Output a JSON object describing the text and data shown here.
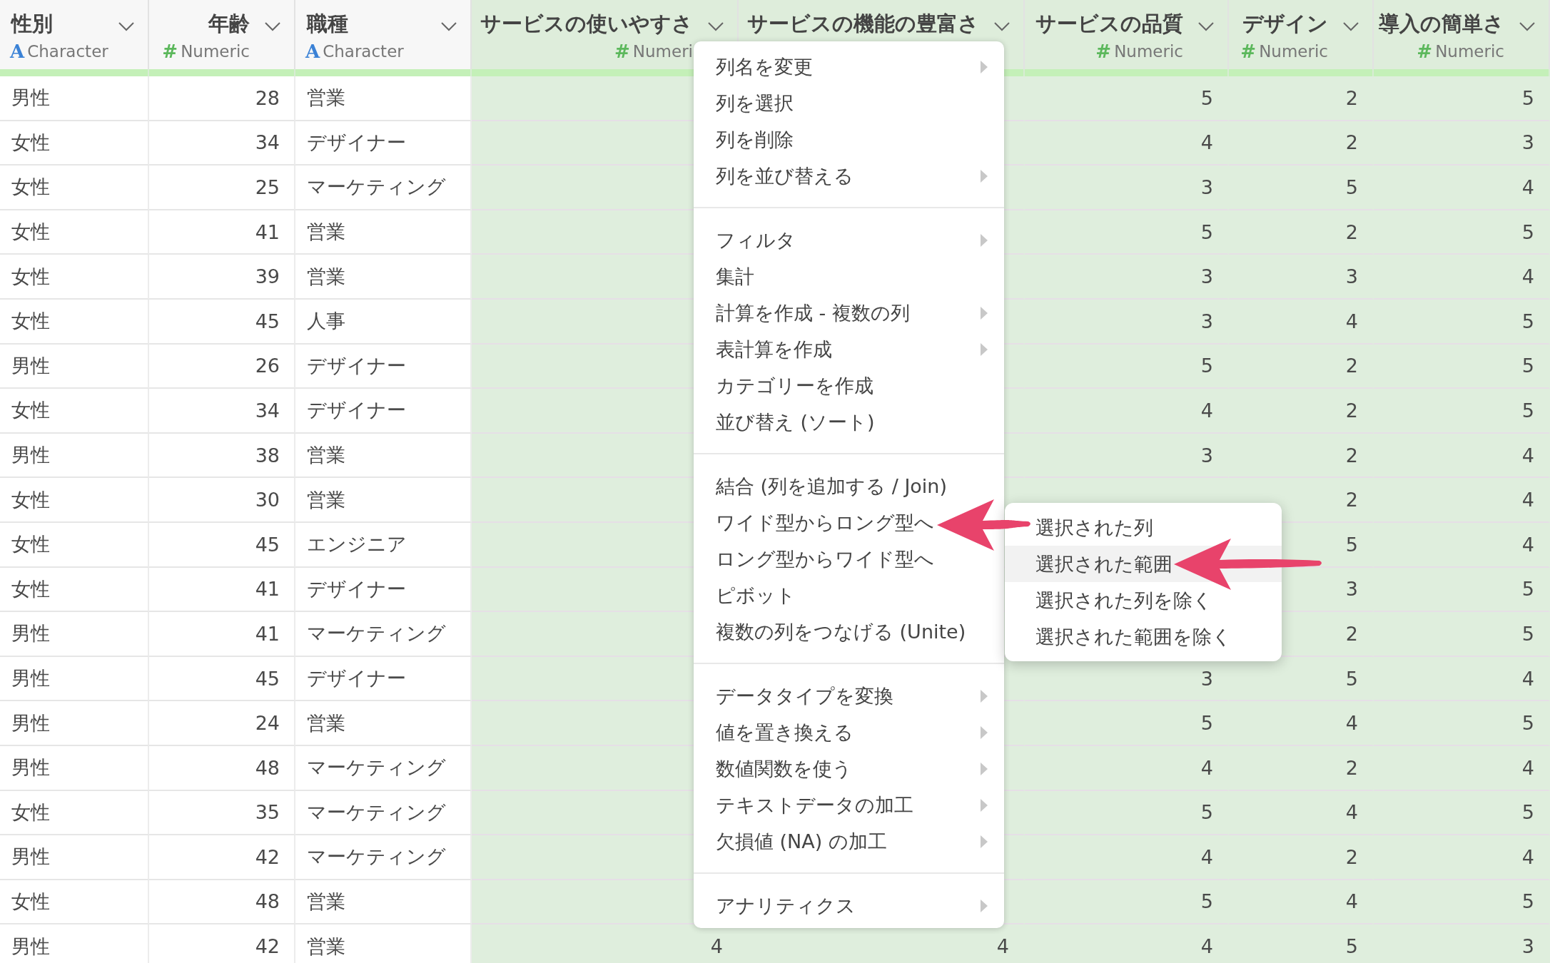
{
  "table": {
    "columns": [
      {
        "title": "性別",
        "selected": false,
        "kind": "character",
        "type": {
          "kind": "character",
          "icon": "A",
          "label": "Character"
        }
      },
      {
        "title": "年齢",
        "selected": false,
        "kind": "numeric",
        "type": {
          "kind": "numeric",
          "icon": "#",
          "label": "Numeric"
        }
      },
      {
        "title": "職種",
        "selected": false,
        "kind": "character",
        "type": {
          "kind": "character",
          "icon": "A",
          "label": "Character"
        }
      },
      {
        "title": "サービスの使いやすさ",
        "selected": true,
        "kind": "numeric",
        "type": {
          "kind": "numeric",
          "icon": "#",
          "label": "Numeri"
        }
      },
      {
        "title": "サービスの機能の豊富さ",
        "selected": true,
        "kind": "numeric"
      },
      {
        "title": "サービスの品質",
        "selected": true,
        "kind": "numeric",
        "type": {
          "kind": "numeric",
          "icon": "#",
          "label": "Numeric"
        }
      },
      {
        "title": "デザイン",
        "selected": true,
        "kind": "numeric",
        "type": {
          "kind": "numeric",
          "icon": "#",
          "label": "Numeric"
        }
      },
      {
        "title": "導入の簡単さ",
        "selected": true,
        "kind": "numeric",
        "type": {
          "kind": "numeric",
          "icon": "#",
          "label": "Numeric"
        }
      }
    ],
    "rows": [
      [
        "男性",
        "28",
        "営業",
        null,
        null,
        "5",
        "2",
        "5"
      ],
      [
        "女性",
        "34",
        "デザイナー",
        null,
        null,
        "4",
        "2",
        "3"
      ],
      [
        "女性",
        "25",
        "マーケティング",
        null,
        null,
        "3",
        "5",
        "4"
      ],
      [
        "女性",
        "41",
        "営業",
        null,
        null,
        "5",
        "2",
        "5"
      ],
      [
        "女性",
        "39",
        "営業",
        null,
        null,
        "3",
        "3",
        "4"
      ],
      [
        "女性",
        "45",
        "人事",
        null,
        null,
        "3",
        "4",
        "5"
      ],
      [
        "男性",
        "26",
        "デザイナー",
        null,
        null,
        "5",
        "2",
        "5"
      ],
      [
        "女性",
        "34",
        "デザイナー",
        null,
        null,
        "4",
        "2",
        "5"
      ],
      [
        "男性",
        "38",
        "営業",
        null,
        null,
        "3",
        "2",
        "4"
      ],
      [
        "女性",
        "30",
        "営業",
        null,
        null,
        null,
        "2",
        "4"
      ],
      [
        "女性",
        "45",
        "エンジニア",
        null,
        null,
        null,
        "5",
        "4"
      ],
      [
        "女性",
        "41",
        "デザイナー",
        null,
        null,
        null,
        "3",
        "5"
      ],
      [
        "男性",
        "41",
        "マーケティング",
        null,
        null,
        null,
        "2",
        "5"
      ],
      [
        "男性",
        "45",
        "デザイナー",
        null,
        null,
        "3",
        "5",
        "4"
      ],
      [
        "男性",
        "24",
        "営業",
        null,
        null,
        "5",
        "4",
        "5"
      ],
      [
        "男性",
        "48",
        "マーケティング",
        null,
        null,
        "4",
        "2",
        "4"
      ],
      [
        "女性",
        "35",
        "マーケティング",
        null,
        null,
        "5",
        "4",
        "5"
      ],
      [
        "男性",
        "42",
        "マーケティング",
        null,
        null,
        "4",
        "2",
        "4"
      ],
      [
        "女性",
        "48",
        "営業",
        null,
        null,
        "5",
        "4",
        "5"
      ],
      [
        "男性",
        "42",
        "営業",
        "4",
        "4",
        "4",
        "5",
        "3"
      ]
    ]
  },
  "context_menu": {
    "groups": [
      [
        {
          "label": "列名を変更",
          "has_submenu": true
        },
        {
          "label": "列を選択",
          "has_submenu": false
        },
        {
          "label": "列を削除",
          "has_submenu": false
        },
        {
          "label": "列を並び替える",
          "has_submenu": true
        }
      ],
      [
        {
          "label": "フィルタ",
          "has_submenu": true
        },
        {
          "label": "集計",
          "has_submenu": false
        },
        {
          "label": "計算を作成 - 複数の列",
          "has_submenu": true
        },
        {
          "label": "表計算を作成",
          "has_submenu": true
        },
        {
          "label": "カテゴリーを作成",
          "has_submenu": false
        },
        {
          "label": "並び替え (ソート)",
          "has_submenu": false
        }
      ],
      [
        {
          "label": "結合 (列を追加する / Join)",
          "has_submenu": false
        },
        {
          "label": "ワイド型からロング型へ",
          "has_submenu": false
        },
        {
          "label": "ロング型からワイド型へ",
          "has_submenu": false
        },
        {
          "label": "ピボット",
          "has_submenu": false
        },
        {
          "label": "複数の列をつなげる (Unite)",
          "has_submenu": false
        }
      ],
      [
        {
          "label": "データタイプを変換",
          "has_submenu": true
        },
        {
          "label": "値を置き換える",
          "has_submenu": true
        },
        {
          "label": "数値関数を使う",
          "has_submenu": true
        },
        {
          "label": "テキストデータの加工",
          "has_submenu": true
        },
        {
          "label": "欠損値 (NA) の加工",
          "has_submenu": true
        }
      ],
      [
        {
          "label": "アナリティクス",
          "has_submenu": true
        }
      ]
    ]
  },
  "submenu": {
    "items": [
      {
        "label": "選択された列",
        "selected": false
      },
      {
        "label": "選択された範囲",
        "selected": true
      },
      {
        "label": "選択された列を除く",
        "selected": false
      },
      {
        "label": "選択された範囲を除く",
        "selected": false
      }
    ]
  }
}
